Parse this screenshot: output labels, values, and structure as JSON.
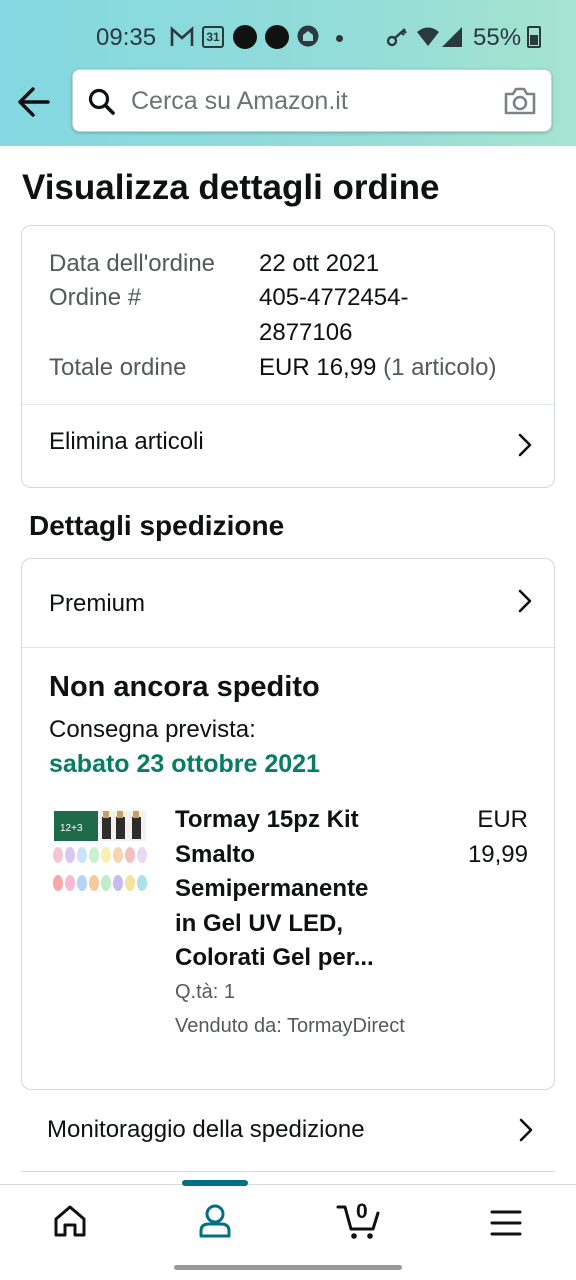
{
  "status_bar": {
    "time": "09:35",
    "calendar_day": "31",
    "battery": "55%",
    "icons": [
      "gmail-icon",
      "calendar-icon",
      "notification-dot",
      "notification-dot",
      "home-icon",
      "small-dot",
      "vpn-key-icon",
      "wifi-icon",
      "signal-icon",
      "battery-icon"
    ]
  },
  "header": {
    "search_placeholder": "Cerca su Amazon.it",
    "accent_gradient": [
      "#84d8e1",
      "#a6e4cf"
    ]
  },
  "page_title": "Visualizza dettagli ordine",
  "order": {
    "date_label": "Data dell'ordine",
    "date_value": "22 ott 2021",
    "number_label": "Ordine #",
    "number_value_line1": "405-4772454-",
    "number_value_line2": "2877106",
    "total_label": "Totale ordine",
    "total_value": "EUR 16,99",
    "total_items": "(1 articolo)",
    "delete_items_label": "Elimina articoli"
  },
  "shipping": {
    "section_title": "Dettagli spedizione",
    "shipping_type": "Premium",
    "status": "Non ancora spedito",
    "delivery_label": "Consegna prevista:",
    "delivery_date": "sabato 23 ottobre 2021",
    "delivery_color": "#067d62",
    "product": {
      "title_lines": [
        "Tormay 15pz Kit",
        "Smalto",
        "Semipermanente",
        "in Gel UV LED,",
        "Colorati Gel per..."
      ],
      "price_currency": "EUR",
      "price_value": "19,99",
      "quantity": "Q.tà: 1",
      "seller": "Venduto da: TormayDirect",
      "image_label": "12+3"
    },
    "tracking_label": "Monitoraggio della spedizione"
  },
  "bottom_nav": {
    "items": [
      "home-icon",
      "account-icon",
      "cart-icon",
      "menu-icon"
    ],
    "active_index": 1,
    "cart_count": "0",
    "active_color": "#007185"
  }
}
